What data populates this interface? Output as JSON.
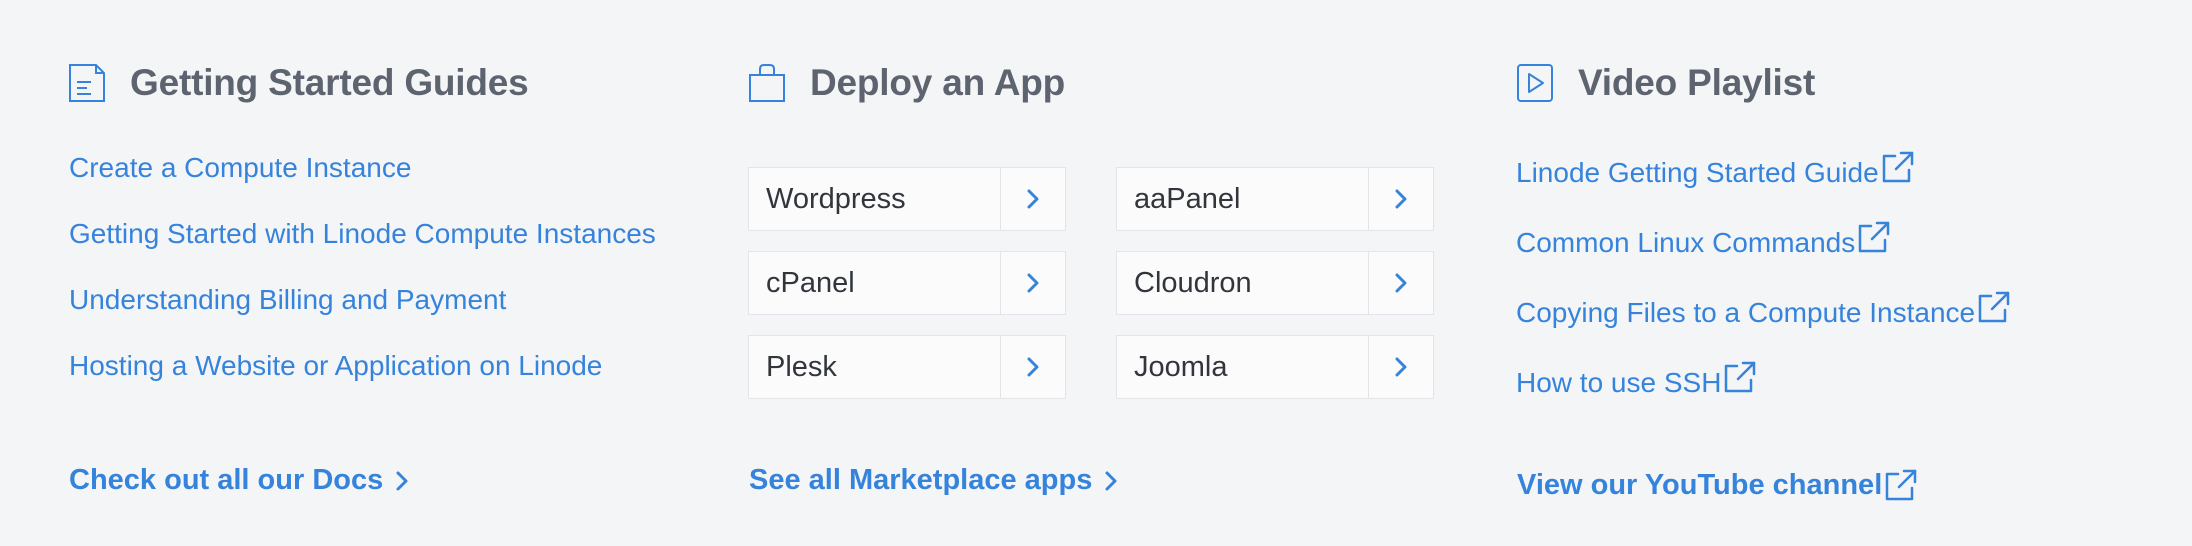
{
  "colors": {
    "link": "#3683dc",
    "heading": "#5d646f",
    "background": "#f4f5f6",
    "card": "#fbfbfb",
    "border": "#e3e5e8"
  },
  "guides": {
    "title": "Getting Started Guides",
    "icon": "document-icon",
    "links": [
      "Create a Compute Instance",
      "Getting Started with Linode Compute Instances",
      "Understanding Billing and Payment",
      "Hosting a Website or Application on Linode"
    ],
    "footer": "Check out all our Docs"
  },
  "deploy": {
    "title": "Deploy an App",
    "icon": "shopping-bag-icon",
    "apps": [
      "Wordpress",
      "aaPanel",
      "cPanel",
      "Cloudron",
      "Plesk",
      "Joomla"
    ],
    "footer": "See all Marketplace apps"
  },
  "videos": {
    "title": "Video Playlist",
    "icon": "play-icon",
    "links": [
      "Linode Getting Started Guide",
      "Common Linux Commands",
      "Copying Files to a Compute Instance",
      "How to use SSH"
    ],
    "footer": "View our YouTube channel"
  }
}
